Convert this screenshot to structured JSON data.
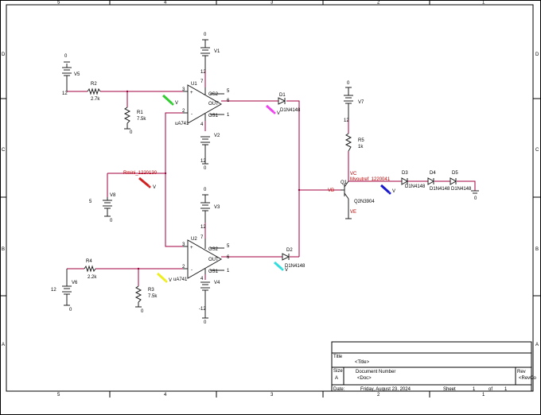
{
  "border": {
    "cols_top": [
      "5",
      "4",
      "3",
      "2",
      "1"
    ],
    "cols_bottom": [
      "5",
      "4",
      "3",
      "2",
      "1"
    ],
    "rows_left": [
      "D",
      "C",
      "B",
      "A"
    ],
    "rows_right": [
      "D",
      "C",
      "B",
      "A"
    ]
  },
  "parts": {
    "V5": {
      "name": "V5",
      "val": "12",
      "gnd": "0"
    },
    "V6": {
      "name": "V6",
      "val": "12",
      "gnd": "0"
    },
    "V8": {
      "name": "V8",
      "val": "5",
      "gnd": "0"
    },
    "V1": {
      "name": "V1",
      "val": "12",
      "gnd": "0"
    },
    "V2": {
      "name": "V2",
      "val": "12",
      "gnd": "0"
    },
    "V3": {
      "name": "V3",
      "val": "12",
      "gnd": "0"
    },
    "V4": {
      "name": "V4",
      "val": "-12",
      "gnd": "0"
    },
    "V7": {
      "name": "V7",
      "val": "12",
      "gnd": "0"
    },
    "R1": {
      "name": "R1",
      "val": "7.5k",
      "gnd": "0"
    },
    "R2": {
      "name": "R2",
      "val": "2.7k"
    },
    "R3": {
      "name": "R3",
      "val": "7.5k",
      "gnd": "0"
    },
    "R4": {
      "name": "R4",
      "val": "2.2k"
    },
    "R5": {
      "name": "R5",
      "val": "1k"
    },
    "U1": {
      "name": "U1",
      "model": "uA741",
      "pins": {
        "p3": "3",
        "p2": "2",
        "p7": "7",
        "p4": "4",
        "p5": "5",
        "p6": "6",
        "p1": "1",
        "os2": "OS2",
        "out": "OUT",
        "os1": "OS1",
        "plus": "+",
        "minus": "-"
      }
    },
    "U2": {
      "name": "U2",
      "model": "uA741",
      "pins": {
        "p3": "3",
        "p2": "2",
        "p7": "7",
        "p4": "4",
        "p5": "5",
        "p6": "6",
        "p1": "1",
        "os2": "OS2",
        "out": "OUT",
        "os1": "OS1",
        "plus": "+",
        "minus": "-"
      }
    },
    "D1": {
      "name": "D1",
      "model": "D1N4148"
    },
    "D2": {
      "name": "D2",
      "model": "D1N4148"
    },
    "D3": {
      "name": "D3",
      "model": "D1N4148"
    },
    "D4": {
      "name": "D4",
      "model": "D1N4148"
    },
    "D5": {
      "name": "D5",
      "model": "D1N4148"
    },
    "Q1": {
      "name": "Q1",
      "model": "Q2N3904",
      "vc": "VC",
      "ve": "VE"
    },
    "gnd_d5": "0"
  },
  "nets": {
    "vb": "VB"
  },
  "probes": {
    "rmini": {
      "label": "Rmini_1220130",
      "color": "#d02020",
      "tag": "V"
    },
    "mvoutref": {
      "label": "Mvoutref_1220041",
      "color": "#1a1acc",
      "tag": "V"
    },
    "green": {
      "color": "#33cc33",
      "tag": "V"
    },
    "magenta": {
      "color": "#ee44ee",
      "tag": "V"
    },
    "yellow": {
      "color": "#eeee22",
      "tag": "V"
    },
    "cyan": {
      "color": "#33dddd",
      "tag": "V"
    }
  },
  "title_block": {
    "title_label": "Title",
    "title_value": "<Title>",
    "size_label": "Size",
    "size_value": "A",
    "docnum_label": "Document Number",
    "docnum_value": "<Doc>",
    "rev_label": "Rev",
    "rev_value": "<RevCo",
    "date_label": "Date:",
    "date_value": "Friday, August 23, 2024",
    "sheet_label": "Sheet",
    "sheet_value": "1",
    "of_label": "of",
    "of_value": "1"
  }
}
